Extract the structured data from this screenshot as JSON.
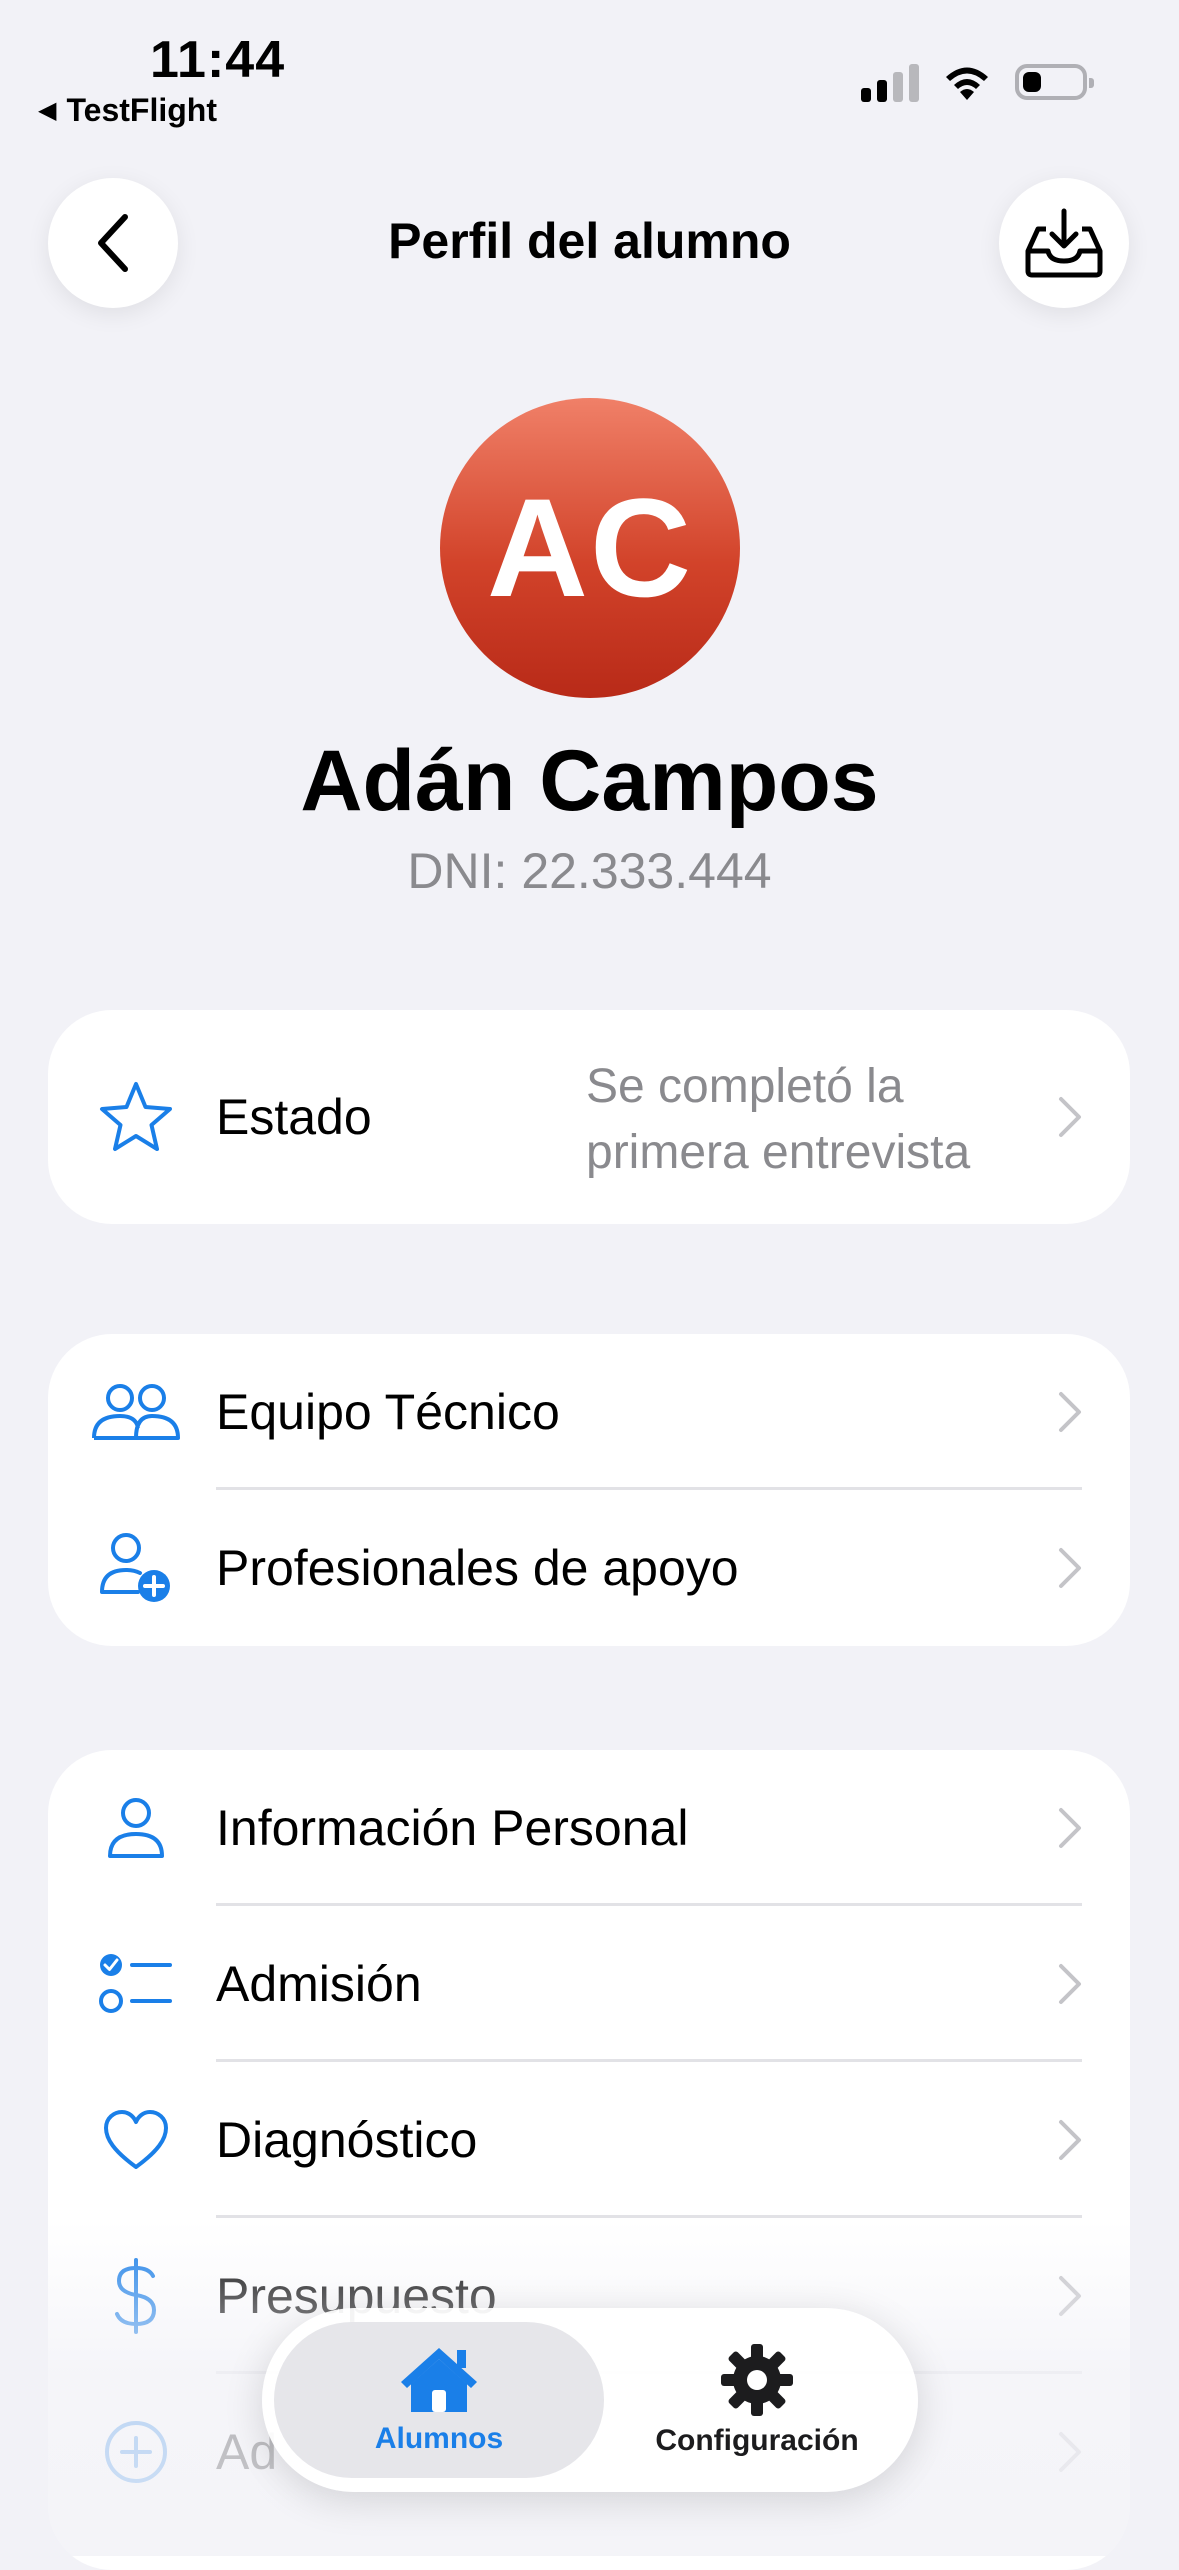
{
  "status_bar": {
    "time": "11:44",
    "back_app": "TestFlight"
  },
  "nav": {
    "title": "Perfil del alumno"
  },
  "profile": {
    "initials": "AC",
    "name": "Adán Campos",
    "dni": "DNI: 22.333.444"
  },
  "estado": {
    "label": "Estado",
    "value": "Se completó la primera entrevista"
  },
  "team_section": [
    {
      "label": "Equipo Técnico",
      "icon": "people-icon"
    },
    {
      "label": "Profesionales de apoyo",
      "icon": "person-add-icon"
    }
  ],
  "info_section": [
    {
      "label": "Información Personal",
      "icon": "person-icon"
    },
    {
      "label": "Admisión",
      "icon": "checklist-icon"
    },
    {
      "label": "Diagnóstico",
      "icon": "heart-icon"
    },
    {
      "label": "Presupuesto",
      "icon": "dollar-icon"
    },
    {
      "label": "Ad",
      "icon": "plus-circle-icon"
    }
  ],
  "tab_bar": {
    "tabs": [
      {
        "label": "Alumnos",
        "icon": "house-icon",
        "active": true
      },
      {
        "label": "Configuración",
        "icon": "gear-icon",
        "active": false
      }
    ]
  },
  "colors": {
    "accent": "#1A7FE8",
    "background": "#F2F2F7",
    "avatar": "#D2432A"
  }
}
